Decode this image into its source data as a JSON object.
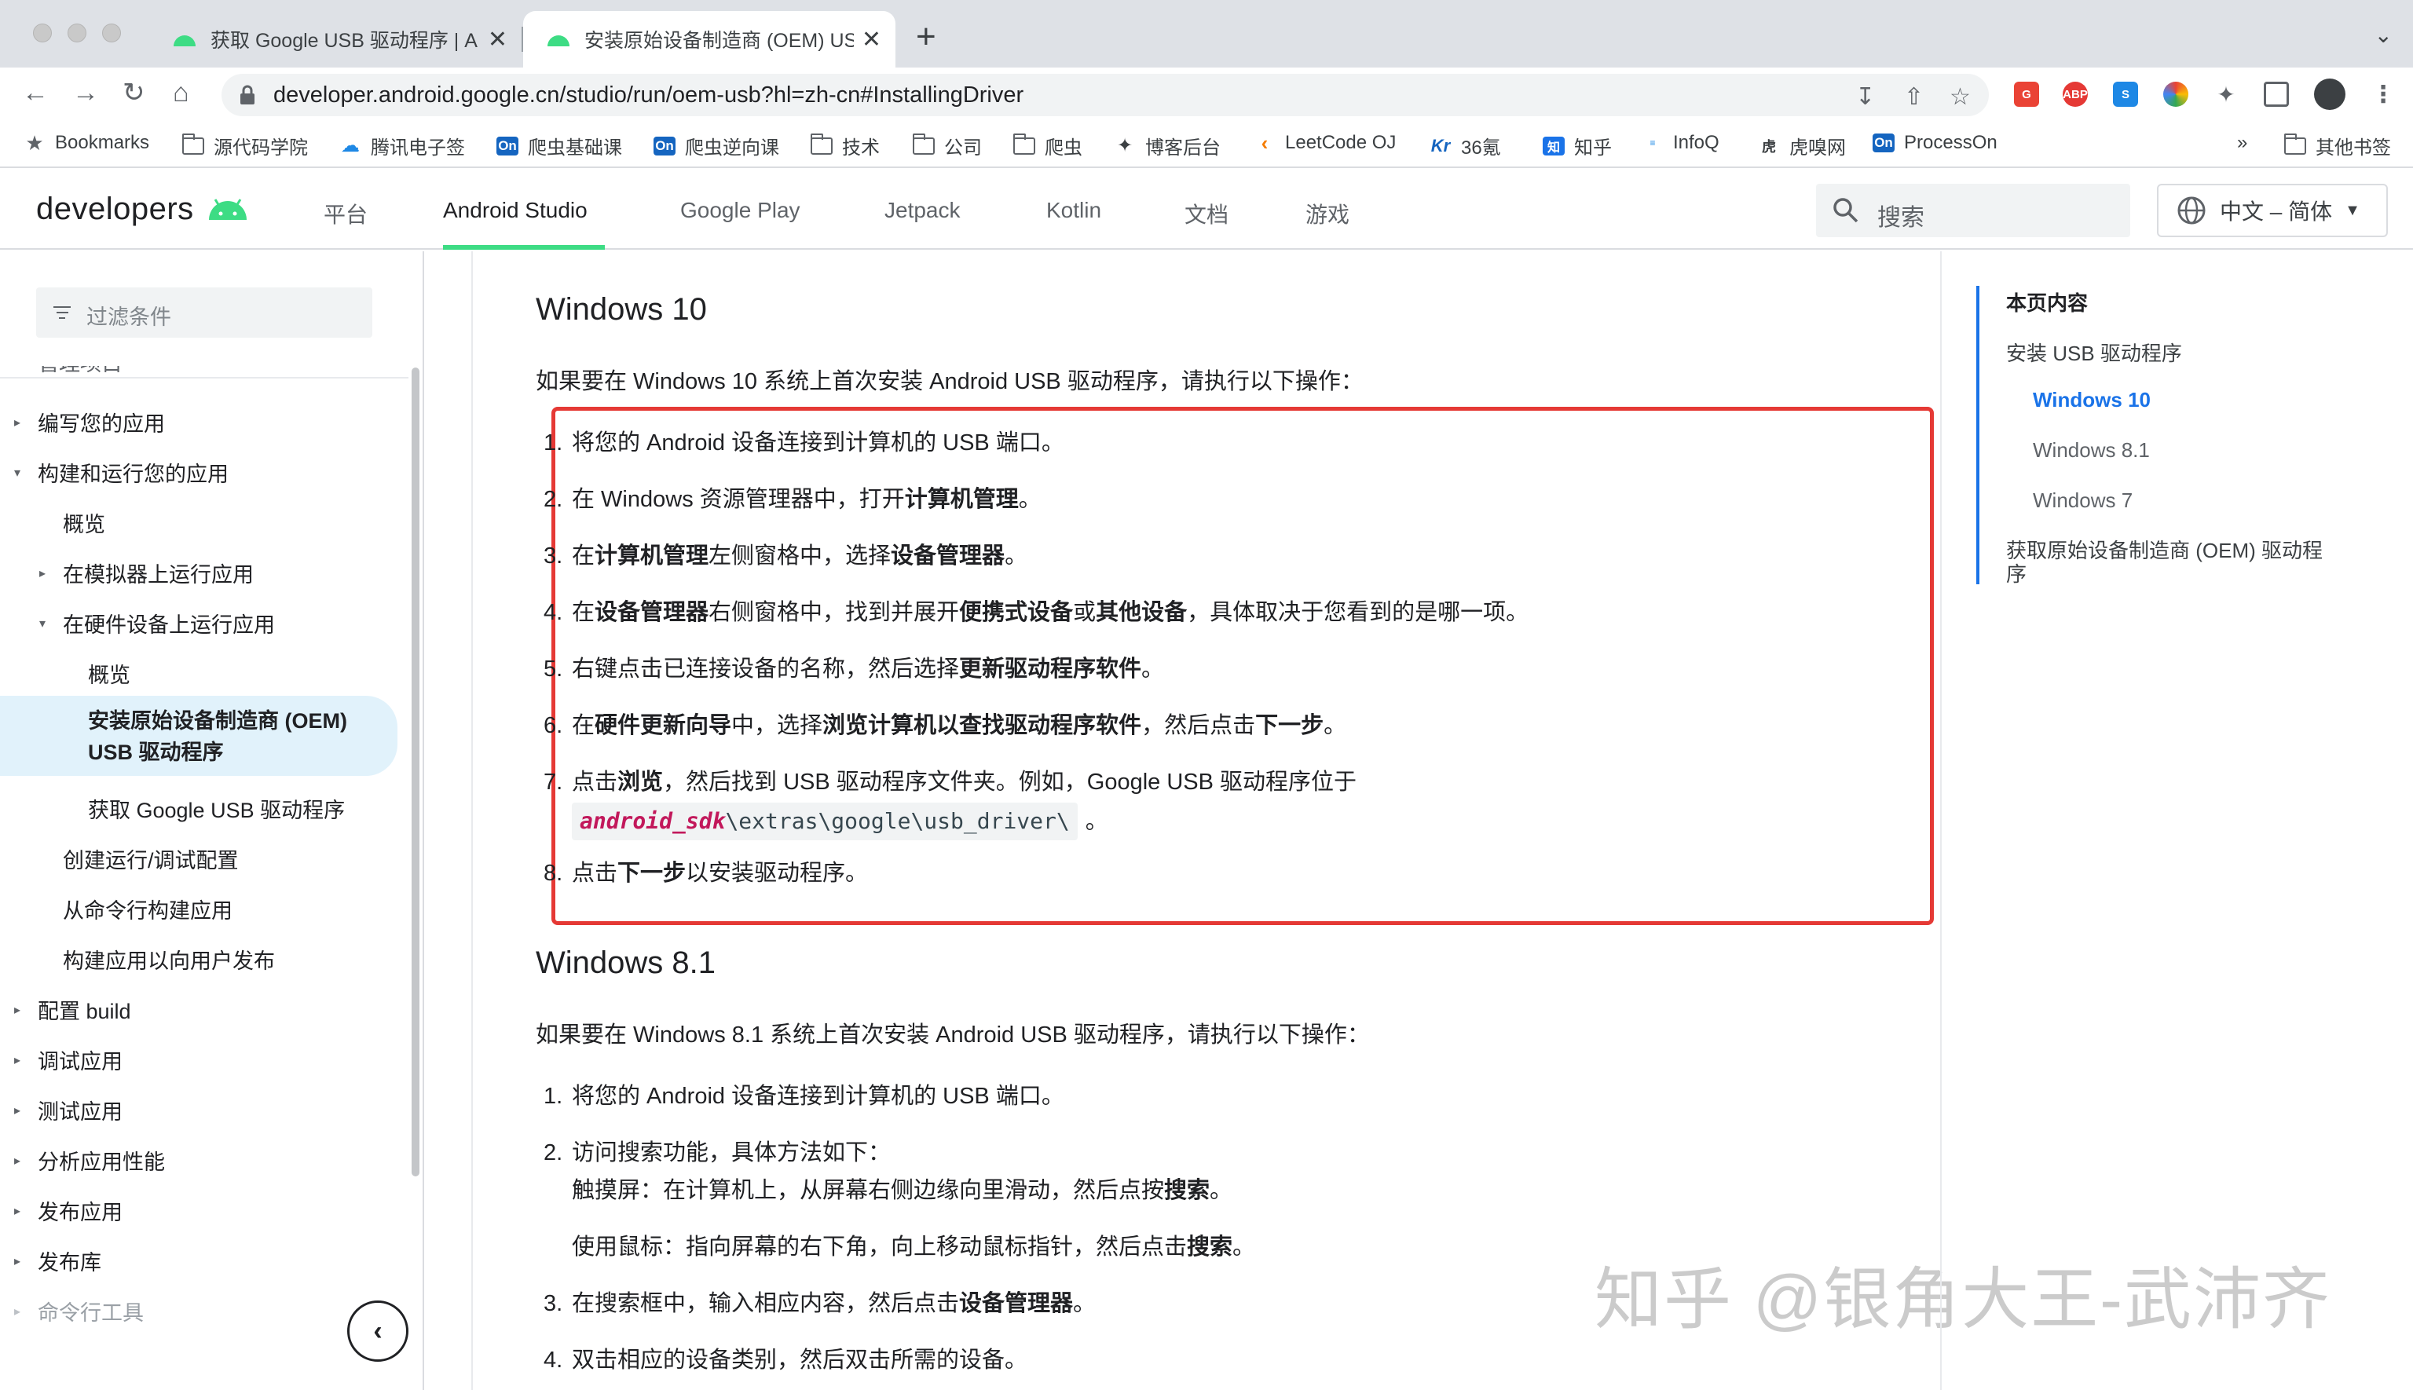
{
  "browser": {
    "tabs": [
      {
        "title": "获取 Google USB 驱动程序 | A",
        "active": false
      },
      {
        "title": "安装原始设备制造商 (OEM) USB",
        "active": true
      }
    ],
    "new_tab": "+",
    "close_glyph": "✕",
    "url": "developer.android.google.cn/studio/run/oem-usb?hl=zh-cn#InstallingDriver",
    "bookmarks": [
      {
        "label": "Bookmarks",
        "icon": "star-icon"
      },
      {
        "label": "源代码学院",
        "icon": "folder-icon"
      },
      {
        "label": "腾讯电子签",
        "icon": "cloud-icon"
      },
      {
        "label": "爬虫基础课",
        "icon": "on-icon"
      },
      {
        "label": "爬虫逆向课",
        "icon": "on-icon"
      },
      {
        "label": "技术",
        "icon": "folder-icon"
      },
      {
        "label": "公司",
        "icon": "folder-icon"
      },
      {
        "label": "爬虫",
        "icon": "folder-icon"
      },
      {
        "label": "博客后台",
        "icon": "blog-icon"
      },
      {
        "label": "LeetCode OJ",
        "icon": "leetcode-icon"
      },
      {
        "label": "36氪",
        "icon": "kr-icon"
      },
      {
        "label": "知乎",
        "icon": "zhihu-icon"
      },
      {
        "label": "InfoQ",
        "icon": "infoq-icon"
      },
      {
        "label": "虎嗅网",
        "icon": "huxiu-icon"
      },
      {
        "label": "ProcessOn",
        "icon": "on-icon"
      }
    ],
    "bookmarks_overflow": "»",
    "other_bookmarks": "其他书签",
    "colors": {
      "tabbar": "#dee1e6",
      "accent": "#1a73e8"
    }
  },
  "site": {
    "logo_text": "developers",
    "nav": [
      "平台",
      "Android Studio",
      "Google Play",
      "Jetpack",
      "Kotlin",
      "文档",
      "游戏"
    ],
    "active_nav": "Android Studio",
    "search_placeholder": "搜索",
    "language": "中文 – 简体",
    "brand_green": "#3ddc84"
  },
  "sidebar": {
    "filter_placeholder": "过滤条件",
    "partial_top": "管理项目",
    "items": [
      {
        "label": "编写您的应用",
        "level": 0,
        "toggle": "collapsed"
      },
      {
        "label": "构建和运行您的应用",
        "level": 0,
        "toggle": "expanded"
      },
      {
        "label": "概览",
        "level": 1,
        "toggle": "none"
      },
      {
        "label": "在模拟器上运行应用",
        "level": 1,
        "toggle": "collapsed"
      },
      {
        "label": "在硬件设备上运行应用",
        "level": 1,
        "toggle": "expanded"
      },
      {
        "label": "概览",
        "level": 2,
        "toggle": "none"
      },
      {
        "label": "安装原始设备制造商 (OEM) USB 驱动程序",
        "level": 2,
        "toggle": "none",
        "selected": true
      },
      {
        "label": "获取 Google USB 驱动程序",
        "level": 2,
        "toggle": "none"
      },
      {
        "label": "创建运行/调试配置",
        "level": 1,
        "toggle": "none"
      },
      {
        "label": "从命令行构建应用",
        "level": 1,
        "toggle": "none"
      },
      {
        "label": "构建应用以向用户发布",
        "level": 1,
        "toggle": "none"
      },
      {
        "label": "配置 build",
        "level": 0,
        "toggle": "collapsed"
      },
      {
        "label": "调试应用",
        "level": 0,
        "toggle": "collapsed"
      },
      {
        "label": "测试应用",
        "level": 0,
        "toggle": "collapsed"
      },
      {
        "label": "分析应用性能",
        "level": 0,
        "toggle": "collapsed"
      },
      {
        "label": "发布应用",
        "level": 0,
        "toggle": "collapsed"
      },
      {
        "label": "发布库",
        "level": 0,
        "toggle": "collapsed"
      },
      {
        "label": "命令行工具",
        "level": 0,
        "toggle": "collapsed"
      }
    ],
    "selected_line1": "安装原始设备制造商 (OEM)",
    "selected_line2": "USB 驱动程序",
    "collapse_glyph": "‹"
  },
  "content": {
    "win10": {
      "heading": "Windows 10",
      "intro": "如果要在 Windows 10 系统上首次安装 Android USB 驱动程序，请执行以下操作：",
      "steps": [
        {
          "n": "1.",
          "parts": [
            {
              "t": "将您的 Android 设备连接到计算机的 USB 端口。"
            }
          ]
        },
        {
          "n": "2.",
          "parts": [
            {
              "t": "在 Windows 资源管理器中，打开"
            },
            {
              "t": "计算机管理",
              "b": true
            },
            {
              "t": "。"
            }
          ]
        },
        {
          "n": "3.",
          "parts": [
            {
              "t": "在"
            },
            {
              "t": "计算机管理",
              "b": true
            },
            {
              "t": "左侧窗格中，选择"
            },
            {
              "t": "设备管理器",
              "b": true
            },
            {
              "t": "。"
            }
          ]
        },
        {
          "n": "4.",
          "parts": [
            {
              "t": "在"
            },
            {
              "t": "设备管理器",
              "b": true
            },
            {
              "t": "右侧窗格中，找到并展开"
            },
            {
              "t": "便携式设备",
              "b": true
            },
            {
              "t": "或"
            },
            {
              "t": "其他设备",
              "b": true
            },
            {
              "t": "，具体取决于您看到的是哪一项。"
            }
          ]
        },
        {
          "n": "5.",
          "parts": [
            {
              "t": "右键点击已连接设备的名称，然后选择"
            },
            {
              "t": "更新驱动程序软件",
              "b": true
            },
            {
              "t": "。"
            }
          ]
        },
        {
          "n": "6.",
          "parts": [
            {
              "t": "在"
            },
            {
              "t": "硬件更新向导",
              "b": true
            },
            {
              "t": "中，选择"
            },
            {
              "t": "浏览计算机以查找驱动程序软件",
              "b": true
            },
            {
              "t": "，然后点击"
            },
            {
              "t": "下一步",
              "b": true
            },
            {
              "t": "。"
            }
          ]
        },
        {
          "n": "7.",
          "parts": [
            {
              "t": "点击"
            },
            {
              "t": "浏览",
              "b": true
            },
            {
              "t": "，然后找到 USB 驱动程序文件夹。例如，Google USB 驱动程序位于"
            }
          ]
        },
        {
          "n": "8.",
          "parts": [
            {
              "t": "点击"
            },
            {
              "t": "下一步",
              "b": true
            },
            {
              "t": "以安装驱动程序。"
            }
          ]
        }
      ],
      "code_var": "android_sdk",
      "code_path": "\\extras\\google\\usb_driver\\",
      "code_after": "。"
    },
    "win81": {
      "heading": "Windows 8.1",
      "intro": "如果要在 Windows 8.1 系统上首次安装 Android USB 驱动程序，请执行以下操作：",
      "steps": [
        {
          "n": "1.",
          "parts": [
            {
              "t": "将您的 Android 设备连接到计算机的 USB 端口。"
            }
          ]
        },
        {
          "n": "2.",
          "parts": [
            {
              "t": "访问搜索功能，具体方法如下："
            }
          ]
        },
        {
          "n": "",
          "parts": [
            {
              "t": "触摸屏：在计算机上，从屏幕右侧边缘向里滑动，然后点按"
            },
            {
              "t": "搜索",
              "b": true
            },
            {
              "t": "。"
            }
          ]
        },
        {
          "n": "",
          "parts": [
            {
              "t": "使用鼠标：指向屏幕的右下角，向上移动鼠标指针，然后点击"
            },
            {
              "t": "搜索",
              "b": true
            },
            {
              "t": "。"
            }
          ]
        },
        {
          "n": "3.",
          "parts": [
            {
              "t": "在搜索框中，输入相应内容，然后点击"
            },
            {
              "t": "设备管理器",
              "b": true
            },
            {
              "t": "。"
            }
          ]
        },
        {
          "n": "4.",
          "parts": [
            {
              "t": "双击相应的设备类别，然后双击所需的设备。"
            }
          ]
        }
      ]
    },
    "highlight_color": "#e53935",
    "watermark": "知乎 @银角大王-武沛齐"
  },
  "toc": {
    "title": "本页内容",
    "items": [
      {
        "label": "安装 USB 驱动程序",
        "state": "normal"
      },
      {
        "label": "Windows 10",
        "state": "active"
      },
      {
        "label": "Windows 8.1",
        "state": "sub"
      },
      {
        "label": "Windows 7",
        "state": "sub"
      },
      {
        "label": "获取原始设备制造商 (OEM) 驱动程序",
        "state": "normal"
      }
    ],
    "last_line1": "获取原始设备制造商 (OEM) 驱动程",
    "last_line2": "序"
  }
}
